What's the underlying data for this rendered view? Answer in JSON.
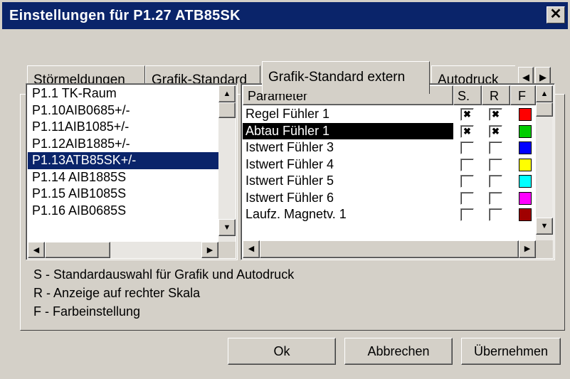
{
  "window": {
    "title": "Einstellungen für P1.27 ATB85SK",
    "close_glyph": "✕"
  },
  "tabs": [
    {
      "label": "Störmeldungen"
    },
    {
      "label": "Grafik-Standard"
    },
    {
      "label": "Grafik-Standard extern",
      "active": true
    },
    {
      "label": "Autodruck"
    }
  ],
  "tab_scroll": {
    "left_glyph": "◀",
    "right_glyph": "▶"
  },
  "stations": [
    {
      "label": "P1.1 TK-Raum"
    },
    {
      "label": "P1.10AIB0685+/-"
    },
    {
      "label": "P1.11AIB1085+/-"
    },
    {
      "label": "P1.12AIB1885+/-"
    },
    {
      "label": "P1.13ATB85SK+/-",
      "selected": true
    },
    {
      "label": "P1.14 AIB1885S"
    },
    {
      "label": "P1.15 AIB1085S"
    },
    {
      "label": "P1.16 AIB0685S"
    }
  ],
  "grid": {
    "headers": {
      "parameter": "Parameter",
      "s": "S.",
      "r": "R",
      "f": "F"
    },
    "rows": [
      {
        "name": "Regel Fühler 1",
        "s": true,
        "r": true,
        "color": "#ff0000",
        "selected": false
      },
      {
        "name": "Abtau Fühler 1",
        "s": true,
        "r": true,
        "color": "#00cc00",
        "selected": true
      },
      {
        "name": "Istwert Fühler 3",
        "s": false,
        "r": false,
        "color": "#0000ff",
        "selected": false
      },
      {
        "name": "Istwert Fühler 4",
        "s": false,
        "r": false,
        "color": "#ffff00",
        "selected": false
      },
      {
        "name": "Istwert Fühler 5",
        "s": false,
        "r": false,
        "color": "#00ffff",
        "selected": false
      },
      {
        "name": "Istwert Fühler 6",
        "s": false,
        "r": false,
        "color": "#ff00ff",
        "selected": false
      },
      {
        "name": "Laufz. Magnetv. 1",
        "s": false,
        "r": false,
        "color": "#a00000",
        "selected": false
      }
    ],
    "check_glyph": "✖"
  },
  "scroll_glyphs": {
    "up": "▲",
    "down": "▼",
    "left": "◀",
    "right": "▶"
  },
  "legend": [
    "S - Standardauswahl für Grafik und Autodruck",
    "R - Anzeige auf rechter Skala",
    "F - Farbeinstellung"
  ],
  "buttons": {
    "ok": "Ok",
    "cancel": "Abbrechen",
    "apply": "Übernehmen"
  }
}
